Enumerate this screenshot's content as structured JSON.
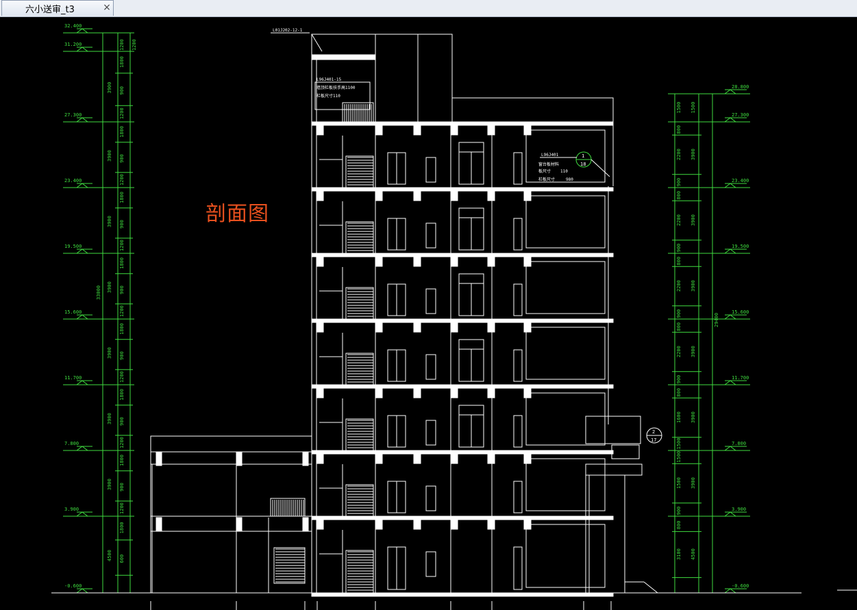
{
  "tab": {
    "title": "六小送审_t3",
    "close_glyph": "×"
  },
  "drawing": {
    "title": "剖面图"
  },
  "left_elevations": [
    "32.400",
    "31.200",
    "27.300",
    "23.400",
    "19.500",
    "15.600",
    "11.700",
    "7.800",
    "3.900",
    "-0.600"
  ],
  "left_dims_inner": [
    "1200",
    "1200",
    "1800",
    "900",
    "1200",
    "1800",
    "900",
    "1200",
    "1800",
    "900",
    "1200",
    "1800",
    "900",
    "1200",
    "1800",
    "900",
    "1200",
    "1800",
    "900",
    "1200",
    "1800",
    "900",
    "1200",
    "1800",
    "600",
    "450"
  ],
  "left_dims_outer": [
    "3900",
    "3900",
    "3900",
    "3900",
    "3900",
    "3900",
    "4500"
  ],
  "left_total": "33000",
  "right_elevations": [
    "28.800",
    "27.300",
    "23.400",
    "19.500",
    "15.600",
    "11.700",
    "7.800",
    "3.900",
    "-0.600"
  ],
  "right_dims_inner": [
    "1500",
    "800",
    "2200",
    "900",
    "800",
    "2200",
    "900",
    "800",
    "2200",
    "900",
    "800",
    "2200",
    "900",
    "800",
    "1600",
    "1500",
    "1500",
    "1500",
    "900",
    "800",
    "3100",
    "600"
  ],
  "right_dims_outer": [
    "1500",
    "3900",
    "3900",
    "3900",
    "3900",
    "3900",
    "3900",
    "4500"
  ],
  "right_total": "29400",
  "annotations": {
    "top_ref": "L01J202-12-1",
    "roof_ref": "L96J401-15",
    "roof_note1": "墙顶栏板扶手高1100",
    "roof_note2": "栏板尺寸110",
    "window_ref": "L96J401",
    "window_note1": "窗台板材料",
    "window_note2": "板尺寸",
    "window_val1": "110",
    "window_note3": "栏板尺寸",
    "window_val2": "980",
    "detail1_num": "1",
    "detail1_sheet": "18",
    "detail2_num": "2",
    "detail2_sheet": "17"
  },
  "colors": {
    "green": "#3fdc3f",
    "white": "#ffffff",
    "title_red": "#e8501e",
    "background": "#000000"
  }
}
